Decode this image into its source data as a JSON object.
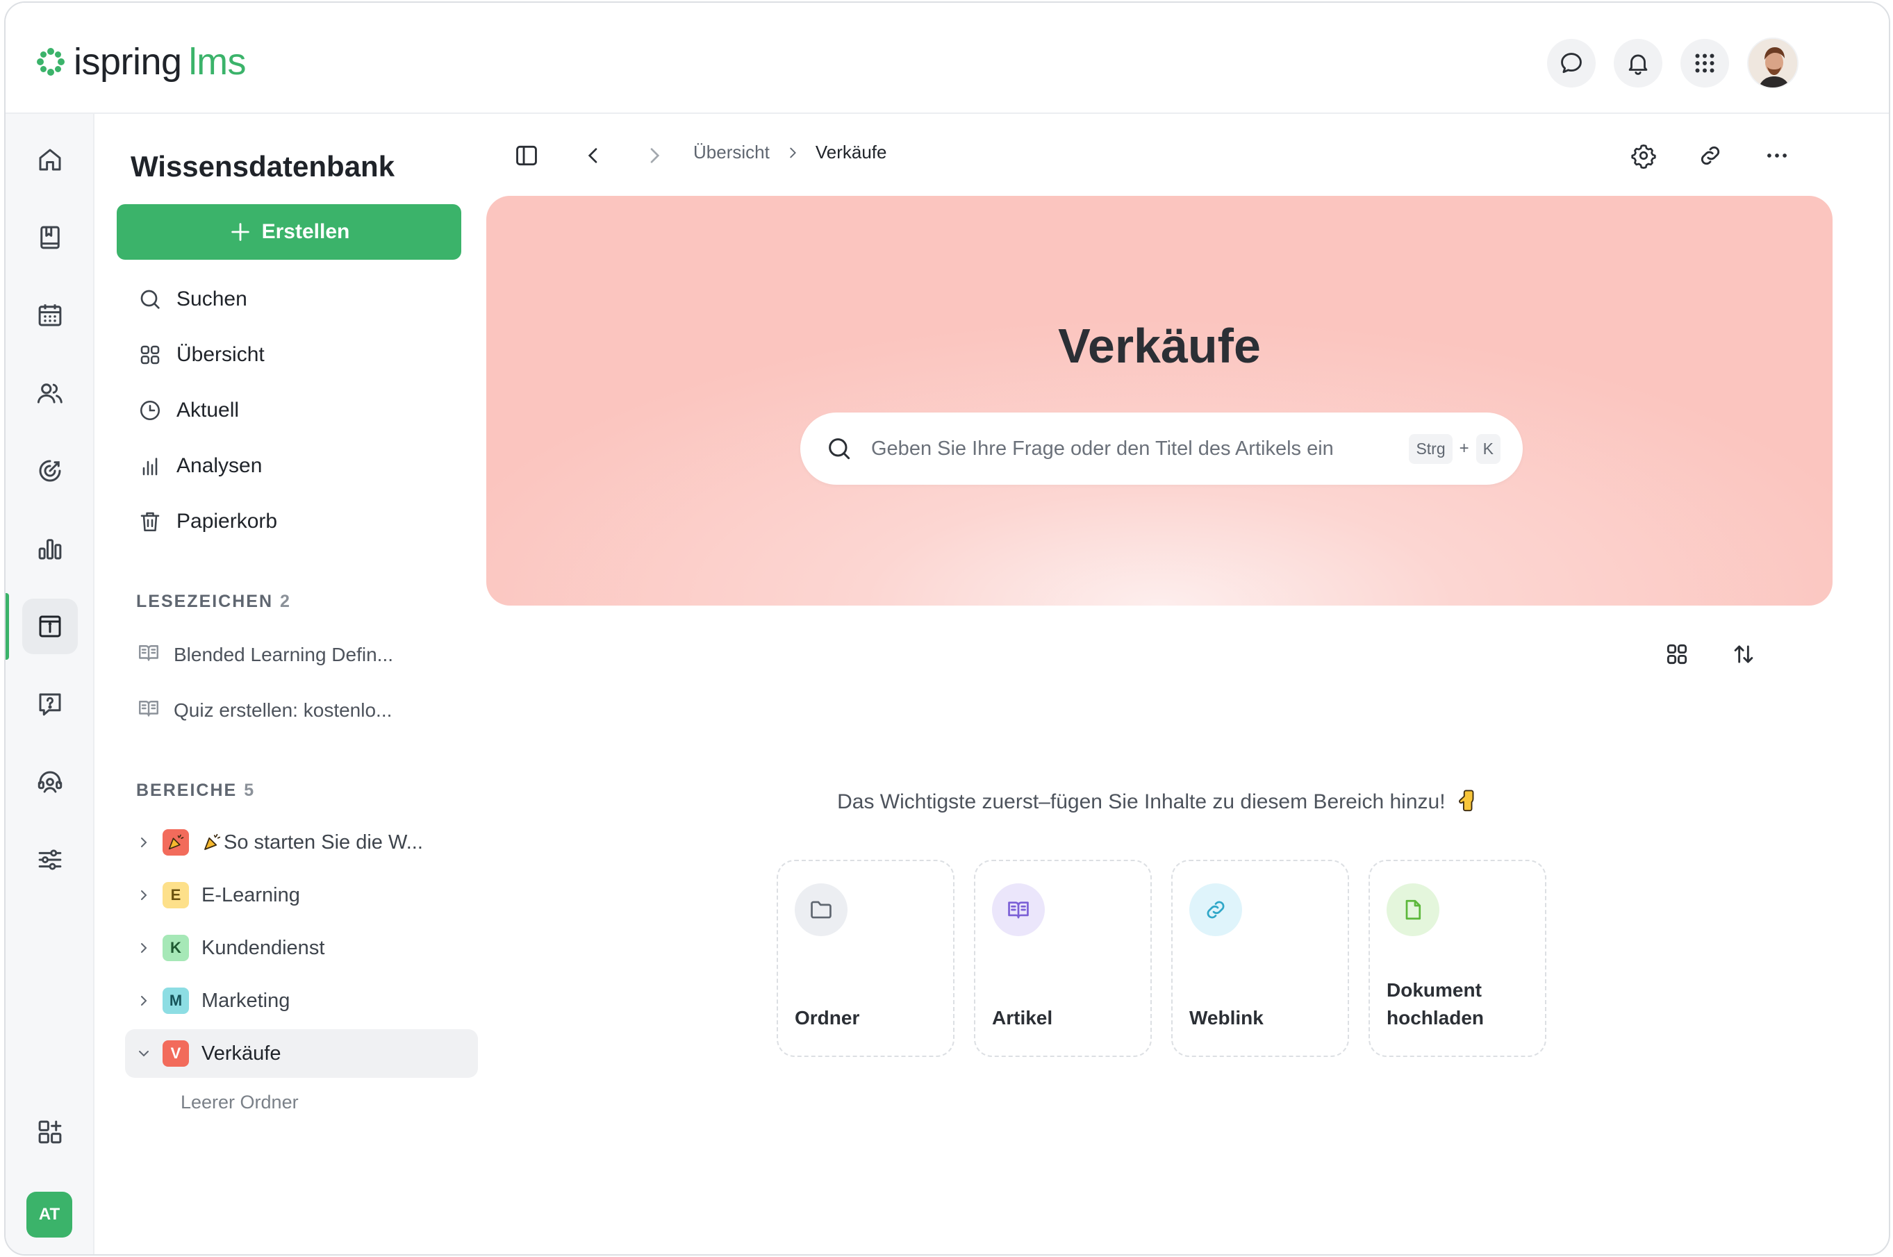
{
  "app": {
    "logo_word": "ispring",
    "logo_suffix": "lms",
    "brand_color": "#3bb36a"
  },
  "topbar": {
    "icons": [
      "chat-icon",
      "bell-icon",
      "apps-grid-icon"
    ],
    "user_avatar": "user-avatar-photo"
  },
  "rail": {
    "items": [
      "home-icon",
      "courses-book-icon",
      "calendar-icon",
      "users-icon",
      "goals-target-icon",
      "reports-chart-icon",
      "knowledge-base-icon",
      "help-question-icon",
      "support-headset-icon",
      "settings-sliders-icon"
    ],
    "active_index": 6,
    "bottom_item": "add-widget-icon",
    "user_initials": "AT"
  },
  "sidebar": {
    "title": "Wissensdatenbank",
    "create_label": "Erstellen",
    "nav": [
      {
        "icon": "search-icon",
        "label": "Suchen"
      },
      {
        "icon": "overview-grid-icon",
        "label": "Übersicht"
      },
      {
        "icon": "clock-icon",
        "label": "Aktuell"
      },
      {
        "icon": "analytics-bars-icon",
        "label": "Analysen"
      },
      {
        "icon": "trash-icon",
        "label": "Papierkorb"
      }
    ],
    "bookmarks": {
      "heading": "LESEZEICHEN",
      "count": "2",
      "items": [
        {
          "label": "Blended Learning Defin..."
        },
        {
          "label": "Quiz erstellen: kostenlo..."
        }
      ]
    },
    "areas": {
      "heading": "BEREICHE",
      "count": "5",
      "items": [
        {
          "badge": "",
          "badge_color": "#f26b5b",
          "label": "So starten Sie die W...",
          "expanded": false
        },
        {
          "badge": "E",
          "badge_color": "#fde08a",
          "label": "E-Learning",
          "expanded": false
        },
        {
          "badge": "K",
          "badge_color": "#a6e8b7",
          "label": "Kundendienst",
          "expanded": false
        },
        {
          "badge": "M",
          "badge_color": "#8ddde3",
          "label": "Marketing",
          "expanded": false
        },
        {
          "badge": "V",
          "badge_color": "#f26b5b",
          "label": "Verkäufe",
          "expanded": true
        }
      ],
      "empty_folder": "Leerer Ordner"
    }
  },
  "main": {
    "breadcrumb": [
      "Übersicht",
      "Verkäufe"
    ],
    "hero_title": "Verkäufe",
    "search_placeholder": "Geben Sie Ihre Frage oder den Titel des Artikels ein",
    "shortcut": {
      "key1": "Strg",
      "plus": "+",
      "key2": "K"
    },
    "empty_message": "Das Wichtigste zuerst–fügen Sie Inhalte zu diesem Bereich hinzu!",
    "cards": [
      {
        "icon": "folder-icon",
        "label": "Ordner",
        "bg": "#eceef2"
      },
      {
        "icon": "article-book-icon",
        "label": "Artikel",
        "bg": "#ebe6fb"
      },
      {
        "icon": "link-icon",
        "label": "Weblink",
        "bg": "#dff4fb"
      },
      {
        "icon": "document-icon",
        "label": "Dokument hochladen",
        "bg": "#e4f6dc"
      }
    ]
  }
}
